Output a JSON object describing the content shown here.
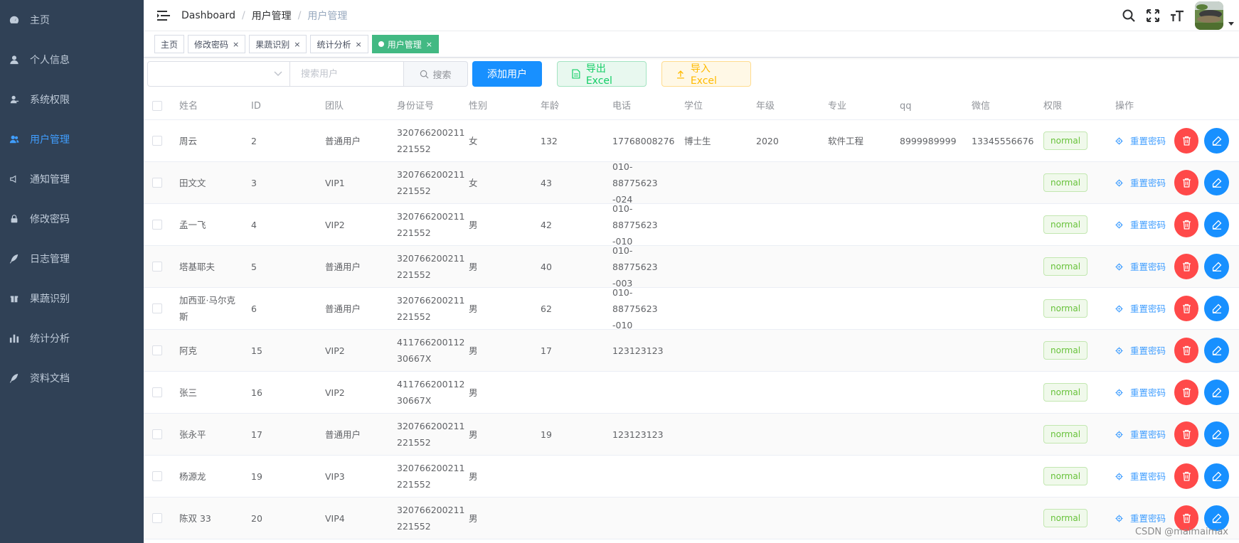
{
  "sidebar": {
    "items": [
      {
        "label": "主页",
        "icon": "dashboard-icon"
      },
      {
        "label": "个人信息",
        "icon": "user-icon"
      },
      {
        "label": "系统权限",
        "icon": "peoples-icon"
      },
      {
        "label": "用户管理",
        "icon": "users-icon",
        "active": true
      },
      {
        "label": "通知管理",
        "icon": "notification-icon"
      },
      {
        "label": "修改密码",
        "icon": "lock-icon"
      },
      {
        "label": "日志管理",
        "icon": "feather-icon"
      },
      {
        "label": "果蔬识别",
        "icon": "gift-icon"
      },
      {
        "label": "统计分析",
        "icon": "chart-icon"
      },
      {
        "label": "资料文档",
        "icon": "feather-icon"
      }
    ]
  },
  "navbar": {
    "breadcrumb": [
      "Dashboard",
      "用户管理",
      "用户管理"
    ]
  },
  "tags": [
    {
      "label": "主页",
      "closable": false
    },
    {
      "label": "修改密码",
      "closable": true
    },
    {
      "label": "果蔬识别",
      "closable": true
    },
    {
      "label": "统计分析",
      "closable": true
    },
    {
      "label": "用户管理",
      "closable": true,
      "active": true
    }
  ],
  "toolbar": {
    "select_value": "",
    "search_placeholder": "搜索用户",
    "search_label": "搜索",
    "add_label": "添加用户",
    "export_label": "导出Excel",
    "import_label": "导入Excel"
  },
  "table": {
    "headers": [
      "姓名",
      "ID",
      "团队",
      "身份证号",
      "性别",
      "年龄",
      "电话",
      "学位",
      "年级",
      "专业",
      "qq",
      "微信",
      "权限",
      "操作"
    ],
    "reset_label": "重置密码",
    "rows": [
      {
        "name": "周云",
        "id": "2",
        "team": "普通用户",
        "idno": [
          "320766200211",
          "221552"
        ],
        "gender": "女",
        "age": "132",
        "phone": [
          "17768008276"
        ],
        "degree": "博士生",
        "grade": "2020",
        "major": "软件工程",
        "qq": "8999989999",
        "wechat": "13345556676",
        "perm": "normal"
      },
      {
        "name": "田文文",
        "id": "3",
        "team": "VIP1",
        "idno": [
          "320766200211",
          "221552"
        ],
        "gender": "女",
        "age": "43",
        "phone": [
          "010-88775623",
          "-024"
        ],
        "degree": "",
        "grade": "",
        "major": "",
        "qq": "",
        "wechat": "",
        "perm": "normal"
      },
      {
        "name": "孟一飞",
        "id": "4",
        "team": "VIP2",
        "idno": [
          "320766200211",
          "221552"
        ],
        "gender": "男",
        "age": "42",
        "phone": [
          "010-88775623",
          "-010"
        ],
        "degree": "",
        "grade": "",
        "major": "",
        "qq": "",
        "wechat": "",
        "perm": "normal"
      },
      {
        "name": "塔基耶夫",
        "id": "5",
        "team": "普通用户",
        "idno": [
          "320766200211",
          "221552"
        ],
        "gender": "男",
        "age": "40",
        "phone": [
          "010-88775623",
          "-003"
        ],
        "degree": "",
        "grade": "",
        "major": "",
        "qq": "",
        "wechat": "",
        "perm": "normal"
      },
      {
        "name": "加西亚·马尔克斯",
        "id": "6",
        "team": "普通用户",
        "idno": [
          "320766200211",
          "221552"
        ],
        "gender": "男",
        "age": "62",
        "phone": [
          "010-88775623",
          "-010"
        ],
        "degree": "",
        "grade": "",
        "major": "",
        "qq": "",
        "wechat": "",
        "perm": "normal"
      },
      {
        "name": "阿克",
        "id": "15",
        "team": "VIP2",
        "idno": [
          "411766200112",
          "30667X"
        ],
        "gender": "男",
        "age": "17",
        "phone": [
          "123123123"
        ],
        "degree": "",
        "grade": "",
        "major": "",
        "qq": "",
        "wechat": "",
        "perm": "normal"
      },
      {
        "name": "张三",
        "id": "16",
        "team": "VIP2",
        "idno": [
          "411766200112",
          "30667X"
        ],
        "gender": "男",
        "age": "",
        "phone": [],
        "degree": "",
        "grade": "",
        "major": "",
        "qq": "",
        "wechat": "",
        "perm": "normal"
      },
      {
        "name": "张永平",
        "id": "17",
        "team": "普通用户",
        "idno": [
          "320766200211",
          "221552"
        ],
        "gender": "男",
        "age": "19",
        "phone": [
          "123123123"
        ],
        "degree": "",
        "grade": "",
        "major": "",
        "qq": "",
        "wechat": "",
        "perm": "normal"
      },
      {
        "name": "杨源龙",
        "id": "19",
        "team": "VIP3",
        "idno": [
          "320766200211",
          "221552"
        ],
        "gender": "男",
        "age": "",
        "phone": [],
        "degree": "",
        "grade": "",
        "major": "",
        "qq": "",
        "wechat": "",
        "perm": "normal"
      },
      {
        "name": "陈双 33",
        "id": "20",
        "team": "VIP4",
        "idno": [
          "320766200211",
          "221552"
        ],
        "gender": "男",
        "age": "",
        "phone": [],
        "degree": "",
        "grade": "",
        "major": "",
        "qq": "",
        "wechat": "",
        "perm": "normal"
      }
    ]
  },
  "watermark": "CSDN @maimaimax",
  "colors": {
    "sidebar_bg": "#304156",
    "active": "#409eff",
    "primary": "#1890ff",
    "success": "#13ce66",
    "warning": "#ffba00",
    "danger": "#ff4949",
    "tag_active": "#42b983"
  }
}
